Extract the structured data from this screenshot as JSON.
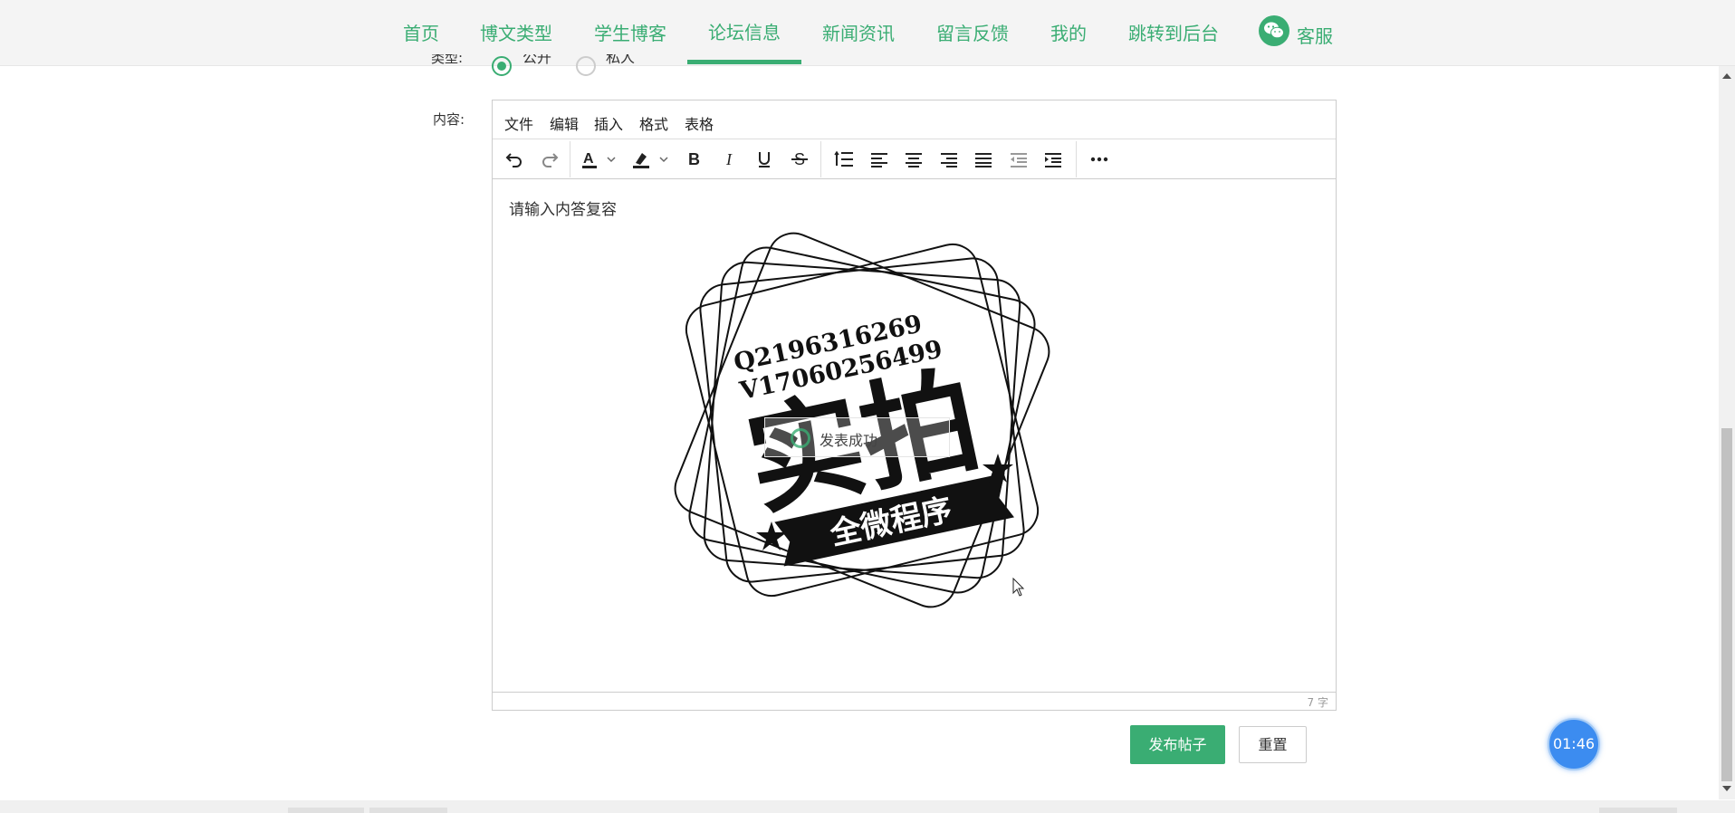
{
  "nav": {
    "items": [
      {
        "label": "首页"
      },
      {
        "label": "博文类型"
      },
      {
        "label": "学生博客"
      },
      {
        "label": "论坛信息",
        "active": true
      },
      {
        "label": "新闻资讯"
      },
      {
        "label": "留言反馈"
      },
      {
        "label": "我的"
      },
      {
        "label": "跳转到后台"
      }
    ],
    "customer_service": {
      "label": "客服",
      "icon": "wechat-icon"
    },
    "accent_color": "#3aad73"
  },
  "form": {
    "type_label": "类型:",
    "type_options": [
      {
        "label": "公开",
        "checked": true
      },
      {
        "label": "私人",
        "checked": false
      }
    ],
    "content_label": "内容:"
  },
  "editor": {
    "menu": [
      "文件",
      "编辑",
      "插入",
      "格式",
      "表格"
    ],
    "toolbar_icons": [
      "undo-icon",
      "redo-icon",
      "text-color-icon",
      "highlight-icon",
      "bold-icon",
      "italic-icon",
      "underline-icon",
      "strikethrough-icon",
      "line-height-icon",
      "align-left-icon",
      "align-center-icon",
      "align-right-icon",
      "align-justify-icon",
      "outdent-icon",
      "indent-icon",
      "more-icon"
    ],
    "placeholder": "请输入内答复容",
    "word_count": "7 字",
    "image": {
      "line1": "Q2196316269",
      "line2": "V17060256499",
      "title": "实拍",
      "banner": "全微程序"
    }
  },
  "toast": {
    "text": "发表成功"
  },
  "buttons": {
    "submit": "发布帖子",
    "reset": "重置"
  },
  "timer": "01:46"
}
